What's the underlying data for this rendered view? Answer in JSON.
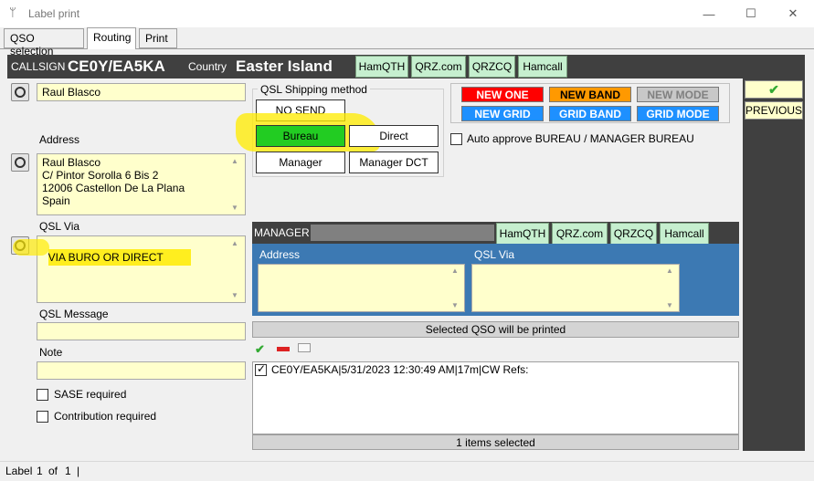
{
  "window": {
    "title": "Label print",
    "minimize": "—",
    "maximize": "☐",
    "close": "✕"
  },
  "tabs": [
    "QSO selection",
    "Routing",
    "Print"
  ],
  "header": {
    "callsign_label": "CALLSIGN",
    "callsign": "CE0Y/EA5KA",
    "country_label": "Country",
    "country": "Easter Island",
    "links": [
      "HamQTH",
      "QRZ.com",
      "QRZCQ",
      "Hamcall"
    ]
  },
  "left": {
    "name": "Raul Blasco",
    "address_label": "Address",
    "address": "Raul Blasco\nC/ Pintor Sorolla 6 Bis 2\n12006 Castellon De La Plana\nSpain",
    "qsl_via_label": "QSL Via",
    "qsl_via": "VIA BURO OR DIRECT",
    "qsl_message_label": "QSL Message",
    "note_label": "Note",
    "sase_label": "SASE required",
    "contribution_label": "Contribution required"
  },
  "shipping": {
    "title": "QSL Shipping method",
    "no_send": "NO SEND",
    "bureau": "Bureau",
    "direct": "Direct",
    "manager": "Manager",
    "manager_dct": "Manager DCT",
    "auto_approve": "Auto approve BUREAU / MANAGER BUREAU"
  },
  "filters": {
    "new_one": "NEW ONE",
    "new_band": "NEW BAND",
    "new_mode": "NEW MODE",
    "new_grid": "NEW GRID",
    "grid_band": "GRID BAND",
    "grid_mode": "GRID MODE"
  },
  "right_panel": {
    "previous": "PREVIOUS"
  },
  "manager": {
    "label": "MANAGER",
    "links": [
      "HamQTH",
      "QRZ.com",
      "QRZCQ",
      "Hamcall"
    ],
    "address_label": "Address",
    "qsl_via_label": "QSL Via"
  },
  "qso": {
    "header": "Selected QSO will be printed",
    "rows": [
      "CE0Y/EA5KA|5/31/2023 12:30:49 AM|17m|CW Refs:"
    ],
    "footer": "1 items selected"
  },
  "status": {
    "label": "Label",
    "current": "1",
    "of": "of",
    "total": "1",
    "sep": "|"
  },
  "colors": {
    "dark_bar": "#404040",
    "accent_blue": "#3c79b3",
    "field_yellow": "#ffffcc",
    "bureau_green": "#22cc22"
  }
}
